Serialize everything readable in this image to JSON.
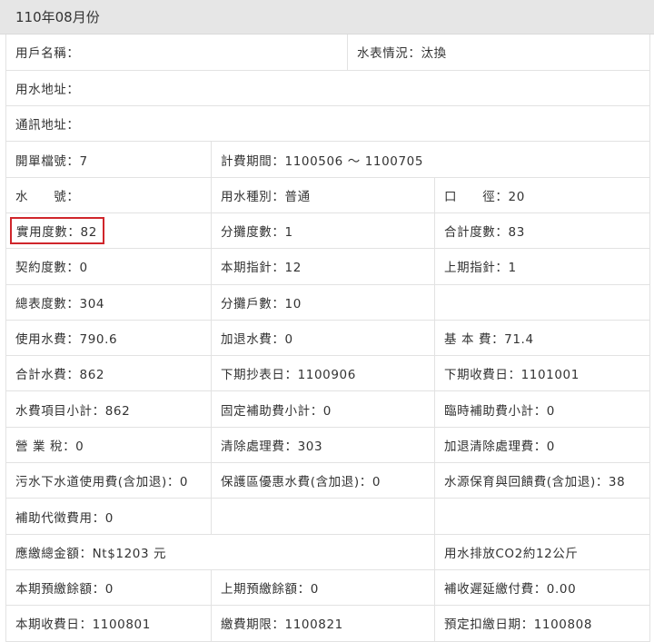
{
  "header": {
    "title": "110年08月份"
  },
  "rows": [
    [
      "用戶名稱：",
      "水表情況：汰換"
    ],
    [
      "用水地址："
    ],
    [
      "通訊地址："
    ],
    [
      "開單檔號：7",
      "計費期間：1100506 ～ 1100705"
    ],
    [
      "水　　號：",
      "用水種別：普通",
      "口　　徑：20"
    ],
    [
      "實用度數：82",
      "分攤度數：1",
      "合計度數：83"
    ],
    [
      "契約度數：0",
      "本期指針：12",
      "上期指針：1"
    ],
    [
      "總表度數：304",
      "分攤戶數：10",
      ""
    ],
    [
      "使用水費：790.6",
      "加退水費：0",
      "基 本 費：71.4"
    ],
    [
      "合計水費：862",
      "下期抄表日：1100906",
      "下期收費日：1101001"
    ],
    [
      "水費項目小計：862",
      "固定補助費小計：0",
      "臨時補助費小計：0"
    ],
    [
      "營 業 稅：0",
      "清除處理費：303",
      "加退清除處理費：0"
    ],
    [
      "污水下水道使用費(含加退)：0",
      "保護區優惠水費(含加退)：0",
      "水源保育與回饋費(含加退)：38"
    ],
    [
      "補助代徵費用：0",
      "",
      ""
    ],
    [
      "應繳總金額：Nt$1203 元",
      "用水排放CO2約12公斤"
    ],
    [
      "本期預繳餘額：0",
      "上期預繳餘額：0",
      "補收遲延繳付費：0.00"
    ],
    [
      "本期收費日：1100801",
      "繳費期限：1100821",
      "預定扣繳日期：1100808"
    ]
  ],
  "highlight_color": "#d0262b"
}
